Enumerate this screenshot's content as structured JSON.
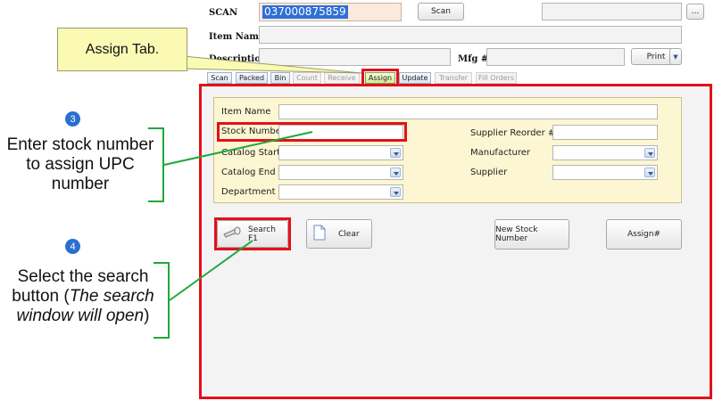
{
  "header": {
    "scan_label": "SCAN",
    "scan_value": "037000875859",
    "scan_button": "Scan",
    "ellipsis_button": "...",
    "item_name_label": "Item Name",
    "description_label": "Description",
    "mfg_label": "Mfg #",
    "print_button": "Print"
  },
  "tabs": [
    {
      "label": "Scan",
      "state": "normal"
    },
    {
      "label": "Packed",
      "state": "normal"
    },
    {
      "label": "Bin",
      "state": "normal"
    },
    {
      "label": "Count",
      "state": "disabled"
    },
    {
      "label": "Receive",
      "state": "disabled"
    },
    {
      "label": "Assign",
      "state": "selected"
    },
    {
      "label": "Update",
      "state": "normal"
    },
    {
      "label": "Transfer",
      "state": "disabled"
    },
    {
      "label": "Fill Orders",
      "state": "disabled"
    }
  ],
  "form": {
    "item_name_label": "Item Name",
    "stock_number_label": "Stock Number",
    "catalog_start_label": "Catalog Start",
    "catalog_end_label": "Catalog End",
    "department_label": "Department",
    "supplier_reorder_label": "Supplier Reorder #",
    "manufacturer_label": "Manufacturer",
    "supplier_label": "Supplier"
  },
  "actions": {
    "search_button": "Search F1",
    "clear_button": "Clear",
    "new_stock_button": "New Stock Number",
    "assign_button": "Assign#"
  },
  "annotations": {
    "callout": "Assign Tab.",
    "step3_number": "3",
    "step3_text": "Enter stock number to assign UPC number",
    "step4_number": "4",
    "step4_text_plain": "Select the search button (",
    "step4_text_italic": "The search window will open",
    "step4_text_close": ")"
  },
  "colors": {
    "highlight_red": "#e2111a",
    "connector_green": "#1fa83a",
    "step_blue": "#2a6fd0",
    "form_panel": "#fdf6d2",
    "callout_fill": "#fafab4"
  }
}
